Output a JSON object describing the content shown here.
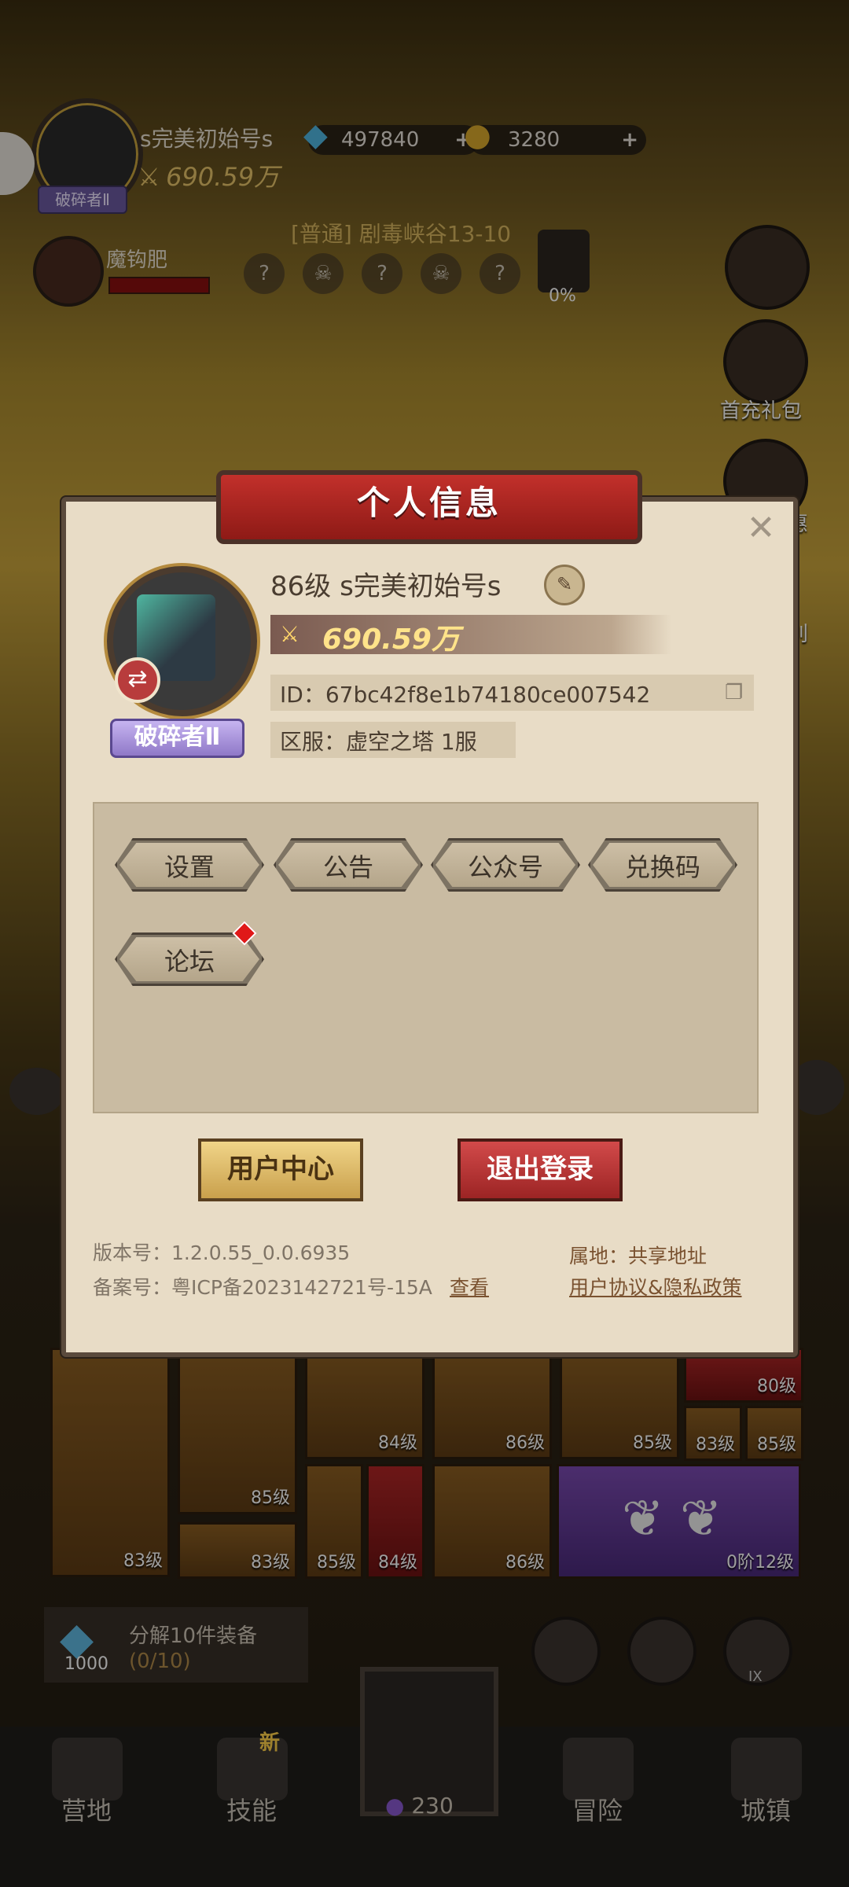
{
  "hud": {
    "player_name": "s完美初始号s",
    "power": "690.59万",
    "rank": "破碎者Ⅱ",
    "diamonds": "497840",
    "coins": "3280",
    "boss_name": "魔钩肥",
    "stage_title": "[普通] 剧毒峡谷13-10",
    "stage_nodes": [
      "?",
      "☠",
      "?",
      "☠",
      "?"
    ],
    "stage_percent": "0%",
    "side_gift_label": "首充礼包",
    "side_partial_1": "惠",
    "side_partial_2": "刖"
  },
  "modal": {
    "title": "个人信息",
    "close_symbol": "✕",
    "level_and_name": "86级  s完美初始号s",
    "power": "690.59万",
    "id_text": "ID：67bc42f8e1b74180ce007542",
    "server_text": "区服：虚空之塔 1服",
    "rank_badge": "破碎者Ⅱ",
    "menu": [
      "设置",
      "公告",
      "公众号",
      "兑换码",
      "论坛"
    ],
    "user_center": "用户中心",
    "logout": "退出登录",
    "version": "版本号：1.2.0.55_0.0.6935",
    "icp": "备案号：粤ICP备2023142721号-15A",
    "icp_view": "查看",
    "region": "属地：共享地址",
    "agreement": "用户协议&隐私政策"
  },
  "inventory": {
    "slots": [
      "83级",
      "85级",
      "84级",
      "86级",
      "85级",
      "80级",
      "83级",
      "85级",
      "83级",
      "85级",
      "84级",
      "86级"
    ],
    "wings_level": "0阶12级",
    "decompose_label": "分解10件装备",
    "decompose_count": "(0/10)",
    "decompose_cost": "1000"
  },
  "nav": {
    "items": [
      "营地",
      "技能",
      "冒险",
      "城镇"
    ],
    "center_value": "230",
    "new_badge": "新",
    "round_badge": "IX"
  }
}
